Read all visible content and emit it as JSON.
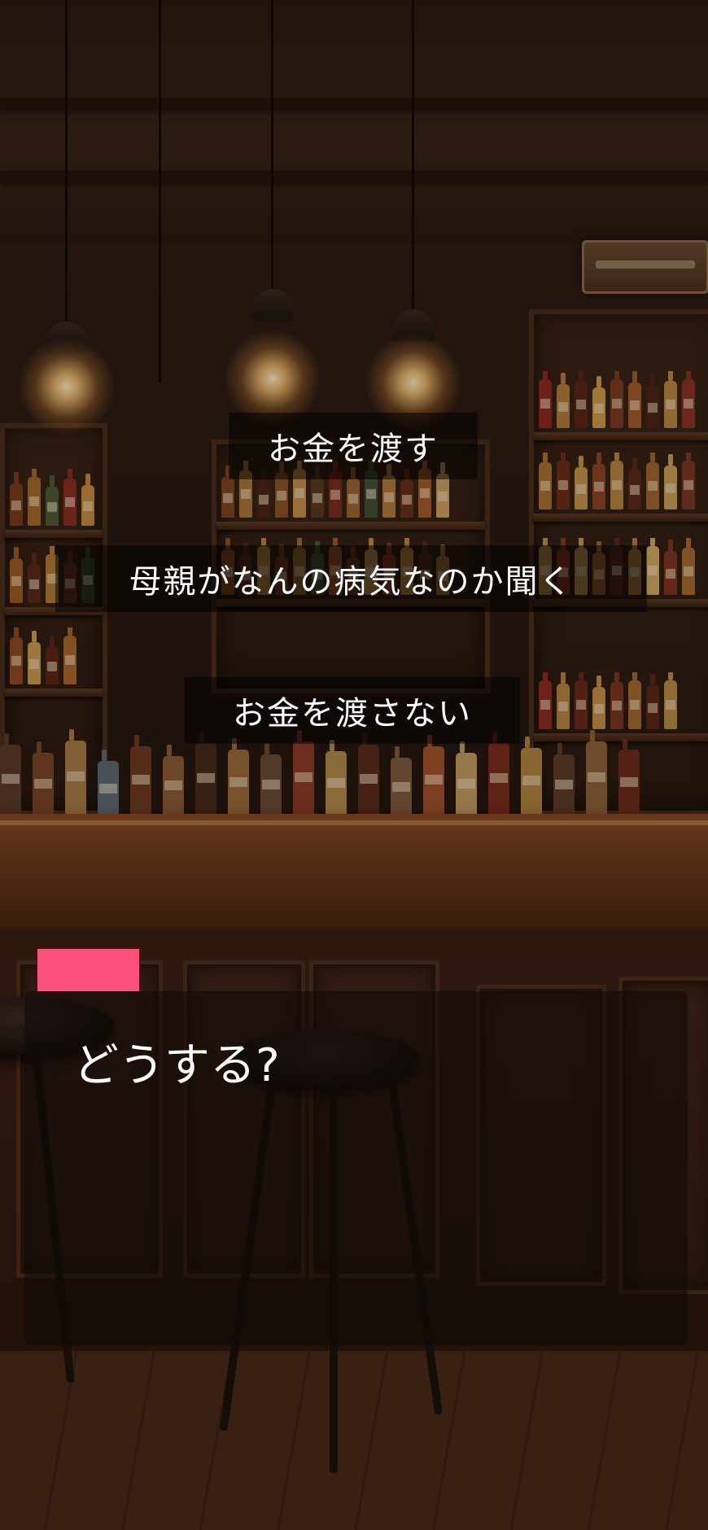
{
  "choices": [
    {
      "label": "お金を渡す"
    },
    {
      "label": "母親がなんの病気なのか聞く"
    },
    {
      "label": "お金を渡さない"
    }
  ],
  "dialog": {
    "speaker_tag_color": "#ff4f7b",
    "text": "どうする?"
  },
  "colors": {
    "choice_background": "rgba(0,0,0,0.52)",
    "dialog_background": "rgba(14,10,8,0.55)",
    "text": "#ffffff"
  },
  "background": {
    "scene": "bar-interior-icon"
  }
}
